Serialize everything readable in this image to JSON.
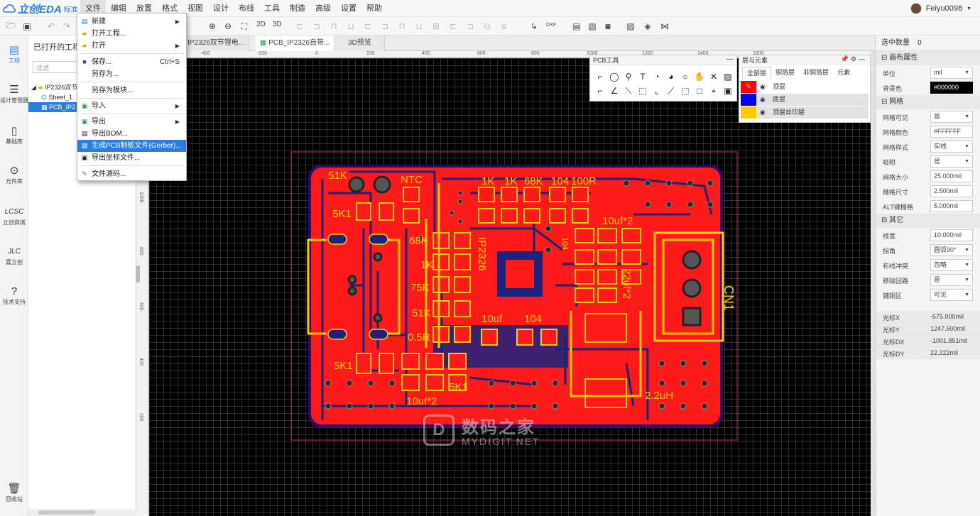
{
  "app": {
    "logo": "立创EDA",
    "edition": "标准",
    "user": "Feiyu0098"
  },
  "menu": [
    "文件",
    "编辑",
    "放置",
    "格式",
    "视图",
    "设计",
    "布线",
    "工具",
    "制造",
    "高级",
    "设置",
    "帮助"
  ],
  "toolbar": {
    "view_2d": "2D",
    "view_3d": "3D",
    "dxf": "DXF"
  },
  "leftnav": [
    {
      "label": "工程",
      "icon": "folder-icon"
    },
    {
      "label": "设计管理器",
      "icon": "list-icon"
    },
    {
      "label": "基础库",
      "icon": "chip-icon"
    },
    {
      "label": "元件库",
      "icon": "search-icon"
    },
    {
      "label": "立创商城",
      "icon": "lcsc-icon"
    },
    {
      "label": "嘉立创",
      "icon": "jlc-icon"
    },
    {
      "label": "技术支持",
      "icon": "help-icon"
    },
    {
      "label": "回收站",
      "icon": "trash-icon"
    }
  ],
  "project": {
    "title": "已打开的工程",
    "filter_placeholder": "过滤",
    "tree": [
      "IP2326双节",
      "Sheet_1",
      "PCB_IP2"
    ]
  },
  "tabs": [
    "IP2326双节锂电...",
    "PCB_IP2326自带...",
    "3D预览"
  ],
  "file_menu": {
    "items": [
      {
        "label": "新建",
        "submenu": true
      },
      {
        "label": "打开工程..."
      },
      {
        "label": "打开",
        "submenu": true
      },
      {
        "label": "保存...",
        "shortcut": "Ctrl+S"
      },
      {
        "label": "另存为..."
      },
      {
        "label": "另存为模块..."
      },
      {
        "label": "导入",
        "submenu": true
      },
      {
        "label": "导出",
        "submenu": true
      },
      {
        "label": "导出BOM..."
      },
      {
        "label": "生成PCB制板文件(Gerber)...",
        "highlighted": true
      },
      {
        "label": "导出坐标文件..."
      },
      {
        "label": "文件源码..."
      }
    ]
  },
  "pcb_tools": {
    "title": "PCB工具"
  },
  "layers_panel": {
    "title": "层与元素",
    "tabs": [
      "全部层",
      "铜箔层",
      "非铜箔层",
      "元素"
    ],
    "layers": [
      {
        "name": "顶层",
        "color": "#ff0000"
      },
      {
        "name": "底层",
        "color": "#0000ff"
      },
      {
        "name": "顶层丝印层",
        "color": "#ffcc00"
      }
    ]
  },
  "rulers": {
    "h": [
      "-400",
      "-200",
      "0",
      "200",
      "400",
      "600",
      "800",
      "1000",
      "1200",
      "1400",
      "1600"
    ],
    "v": [
      "1000",
      "800",
      "600",
      "400",
      "200"
    ]
  },
  "pcb": {
    "silk_labels": [
      "51K",
      "NTC",
      "1K",
      "1K",
      "68K",
      "104",
      "100R",
      "5K1",
      "10uf*2",
      "68K",
      "1K",
      "75K",
      "51K",
      "0.5R",
      "10uf",
      "104",
      "22uf*2",
      "CN1",
      "5K1",
      "10uf*2",
      "5K1",
      "2.2uH",
      "IP2326",
      "104"
    ],
    "colors": {
      "copper_top": "#ff1a1a",
      "copper_bottom": "#1a237e",
      "silk": "#ffcc00",
      "outline": "#7b1fa2"
    }
  },
  "watermark": {
    "cn": "数码之家",
    "en": "MYDIGIT.NET"
  },
  "right_panel": {
    "selection_label": "选中数量",
    "selection_count": "0",
    "sections": [
      {
        "title": "画布属性",
        "rows": [
          {
            "label": "单位",
            "value": "mil",
            "dropdown": true
          },
          {
            "label": "背景色",
            "value": "#000000",
            "dark": true
          }
        ]
      },
      {
        "title": "网格",
        "rows": [
          {
            "label": "网格可见",
            "value": "是",
            "dropdown": true
          },
          {
            "label": "网格颜色",
            "value": "#FFFFFF"
          },
          {
            "label": "网格样式",
            "value": "实线",
            "dropdown": true
          },
          {
            "label": "吸附",
            "value": "是",
            "dropdown": true
          },
          {
            "label": "网格大小",
            "value": "25.000mil"
          },
          {
            "label": "栅格尺寸",
            "value": "2.500mil"
          },
          {
            "label": "ALT键栅格",
            "value": "5.000mil"
          }
        ]
      },
      {
        "title": "其它",
        "rows": [
          {
            "label": "线宽",
            "value": "10.000mil"
          },
          {
            "label": "拐角",
            "value": "圆弧90°",
            "dropdown": true
          },
          {
            "label": "布线冲突",
            "value": "忽略",
            "dropdown": true
          },
          {
            "label": "移除回路",
            "value": "是",
            "dropdown": true
          },
          {
            "label": "铺铜区",
            "value": "可见",
            "dropdown": true
          }
        ]
      }
    ],
    "cursor": [
      {
        "label": "光标X",
        "value": "-575.000mil"
      },
      {
        "label": "光标Y",
        "value": "1247.500mil"
      },
      {
        "label": "光标DX",
        "value": "-1001.851mil"
      },
      {
        "label": "光标DY",
        "value": "22.222mil"
      }
    ]
  }
}
